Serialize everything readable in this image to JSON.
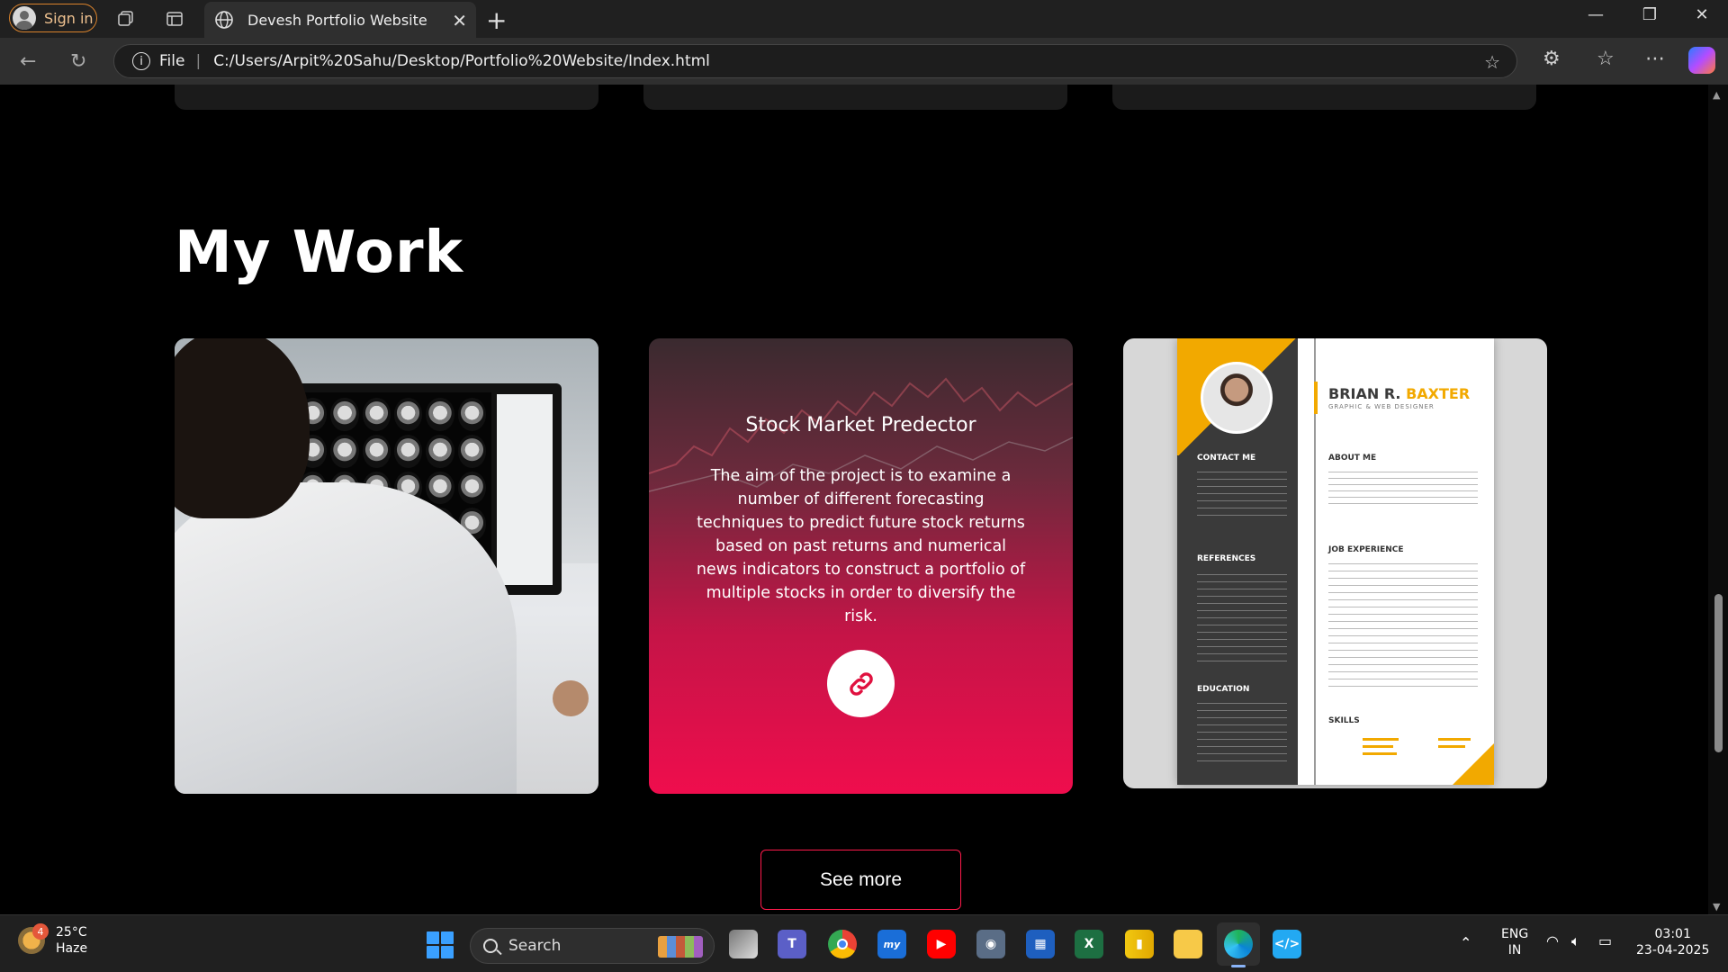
{
  "browser": {
    "signin_label": "Sign in",
    "tab_title": "Devesh Portfolio Website",
    "url_scheme": "File",
    "url": "C:/Users/Arpit%20Sahu/Desktop/Portfolio%20Website/Index.html"
  },
  "page": {
    "section_title": "My Work",
    "works": [
      {
        "kind": "image",
        "subject": "doctor-reviewing-brain-scans"
      },
      {
        "kind": "overlay",
        "title": "Stock Market Predector",
        "description": "The aim of the project is to examine a number of different forecasting techniques to predict future stock returns based on past returns and numerical news indicators to construct a portfolio of multiple stocks in order to diversify the risk.",
        "link_icon": "link-icon"
      },
      {
        "kind": "image",
        "subject": "resume-template",
        "resume": {
          "first_name": "BRIAN R.",
          "last_name": "BAXTER",
          "role": "GRAPHIC & WEB DESIGNER",
          "contact_heading": "CONTACT ME",
          "references_heading": "REFERENCES",
          "education_heading": "EDUCATION",
          "about_heading": "ABOUT ME",
          "job_heading": "JOB EXPERIENCE",
          "skills_heading": "SKILLS"
        }
      }
    ],
    "see_more_label": "See more"
  },
  "taskbar": {
    "temperature": "25°C",
    "condition": "Haze",
    "weather_badge": "4",
    "search_label": "Search",
    "language": "ENG",
    "region": "IN",
    "time": "03:01",
    "date": "23-04-2025"
  },
  "colors": {
    "accent": "#ff1a4b",
    "resume_yellow": "#f2a900",
    "background": "#000000"
  }
}
